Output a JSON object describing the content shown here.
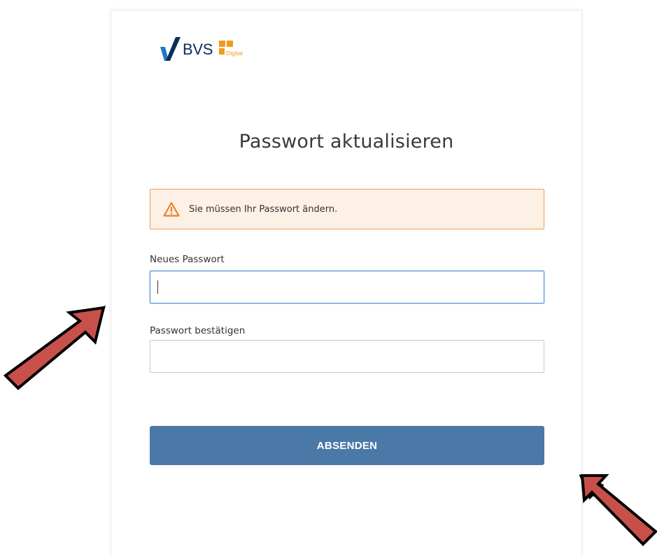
{
  "logo": {
    "brand": "BVS",
    "sub": "Digital",
    "accent_color": "#f29a1d",
    "brand_color": "#0b2d5b"
  },
  "title": "Passwort aktualisieren",
  "alert": {
    "icon": "warning-triangle-icon",
    "text": "Sie müssen Ihr Passwort ändern.",
    "background": "#fdf0e5",
    "border": "#ec9d5b"
  },
  "form": {
    "new_password": {
      "label": "Neues Passwort",
      "value": ""
    },
    "confirm_password": {
      "label": "Passwort bestätigen",
      "value": ""
    },
    "submit_label": "ABSENDEN",
    "submit_color": "#4a79a8"
  },
  "annotations": {
    "arrow_color": "#c8504b"
  }
}
